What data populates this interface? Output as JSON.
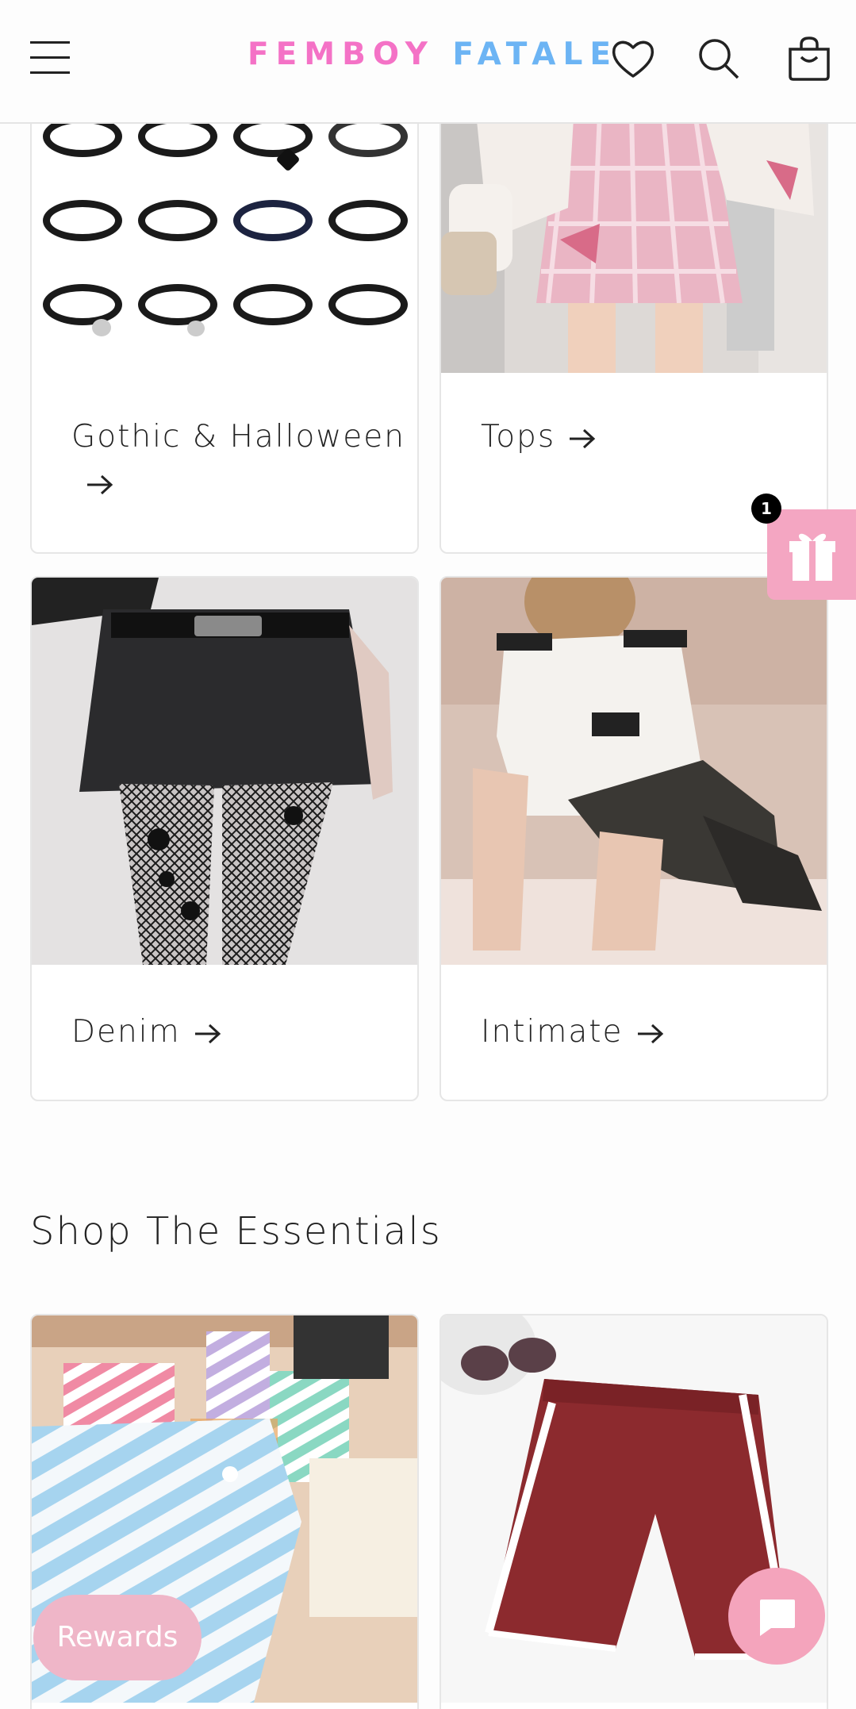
{
  "header": {
    "logo_part1": "FEMBOY",
    "logo_part2": "FATALE",
    "menu_icon": "hamburger-icon",
    "wishlist_icon": "heart-icon",
    "search_icon": "search-icon",
    "cart_icon": "cart-icon"
  },
  "collections": [
    {
      "label": "Gothic & Halloween",
      "image": "chokers-photo"
    },
    {
      "label": "Tops",
      "image": "plaid-skirt-cardigan-photo"
    },
    {
      "label": "Denim",
      "image": "denim-skirt-fishnet-photo"
    },
    {
      "label": "Intimate",
      "image": "police-costume-photo"
    }
  ],
  "essentials": {
    "title": "Shop The Essentials",
    "products": [
      {
        "image": "striped-underwear-photo"
      },
      {
        "image": "maroon-shorts-photo"
      }
    ]
  },
  "widgets": {
    "gift_badge_count": "1",
    "rewards_label": "Rewards",
    "chat_icon": "chat-bubble-icon",
    "gift_icon": "gift-icon"
  },
  "colors": {
    "logo_pink": "#f472c6",
    "logo_blue": "#6cb4f4",
    "accent_pink": "#f4a6c2"
  }
}
